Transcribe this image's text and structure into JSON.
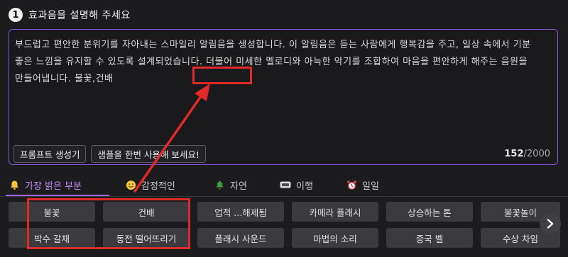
{
  "step": {
    "number": "1",
    "title": "효과음을 설명해 주세요"
  },
  "description": {
    "text": "부드럽고 편안한 분위기를 자아내는 스마일리 알림음을 생성합니다. 이 알림음은 듣는 사람에게 행복감을 주고, 일상 속에서 기분 좋은 느낌을 유지할 수 있도록 설계되었습니다. 더불어 미세한 멜로디와 아늑한 악기를 조합하여 마음을 편안하게 해주는 음원을 만들어냅니다.",
    "keywords": "불꽃,건배"
  },
  "buttons": {
    "prompt_generator": "프롬프트 생성기",
    "try_sample": "샘플을 한번 사용해 보세요!"
  },
  "counter": {
    "current": "152",
    "max": "/2000"
  },
  "tabs": [
    {
      "label": "가장 밝은 부분",
      "icon": "bell-icon"
    },
    {
      "label": "감정적인",
      "icon": "smiley-icon"
    },
    {
      "label": "자연",
      "icon": "tree-icon"
    },
    {
      "label": "이행",
      "icon": "transition-icon"
    },
    {
      "label": "일일",
      "icon": "alarm-clock-icon"
    }
  ],
  "chips_row1": [
    "불꽃",
    "건배",
    "업적 ...해제됨",
    "카메라 플래시",
    "상승하는 톤",
    "불꽃놀이"
  ],
  "chips_row2": [
    "박수 갈채",
    "동전 떨어뜨리기",
    "플래시 사운드",
    "마법의 소리",
    "중국 벨",
    "수상 차임"
  ],
  "colors": {
    "accent": "#a764ee",
    "highlight": "#e02a2a",
    "chip_bg": "#3a3a3f",
    "background": "#1c1c1f"
  }
}
